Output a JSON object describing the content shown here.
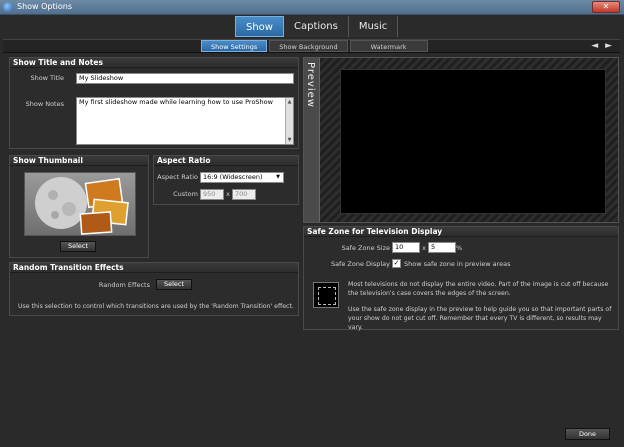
{
  "window": {
    "title": "Show Options",
    "close_label": "✕"
  },
  "main_tabs": [
    {
      "label": "Show",
      "active": true
    },
    {
      "label": "Captions",
      "active": false
    },
    {
      "label": "Music",
      "active": false
    }
  ],
  "sub_tabs": [
    {
      "label": "Show Settings",
      "active": true
    },
    {
      "label": "Show Background",
      "active": false
    },
    {
      "label": "Watermark",
      "active": false
    }
  ],
  "nav_arrows": "◄ ►",
  "title_notes": {
    "header": "Show Title and Notes",
    "title_label": "Show Title",
    "title_value": "My Slideshow",
    "notes_label": "Show Notes",
    "notes_value": "My first slideshow made while learning how to use ProShow"
  },
  "thumbnail": {
    "header": "Show Thumbnail",
    "select_label": "Select"
  },
  "aspect": {
    "header": "Aspect Ratio",
    "ratio_label": "Aspect Ratio",
    "ratio_value": "16:9 (Widescreen)",
    "custom_label": "Custom",
    "custom_w": "950",
    "custom_x": "x",
    "custom_h": "700"
  },
  "transitions": {
    "header": "Random Transition Effects",
    "effects_label": "Random Effects",
    "select_label": "Select",
    "description": "Use this selection to control which transitions are used by the 'Random Transition' effect."
  },
  "preview": {
    "label": "Preview"
  },
  "safe_zone": {
    "header": "Safe Zone for Television Display",
    "size_label": "Safe Zone Size",
    "size_w": "10",
    "size_x": "x",
    "size_h": "5",
    "size_unit": "%",
    "display_label": "Safe Zone Display",
    "checkbox_checked": true,
    "checkbox_text": "Show safe zone in preview areas",
    "desc1": "Most televisions do not display the entire video. Part of the image is cut off because the television's case covers the edges of the screen.",
    "desc2": "Use the safe zone display in the preview to help guide you so that important parts of your show do not get cut off. Remember that every TV is different, so results may vary."
  },
  "footer": {
    "done_label": "Done"
  }
}
